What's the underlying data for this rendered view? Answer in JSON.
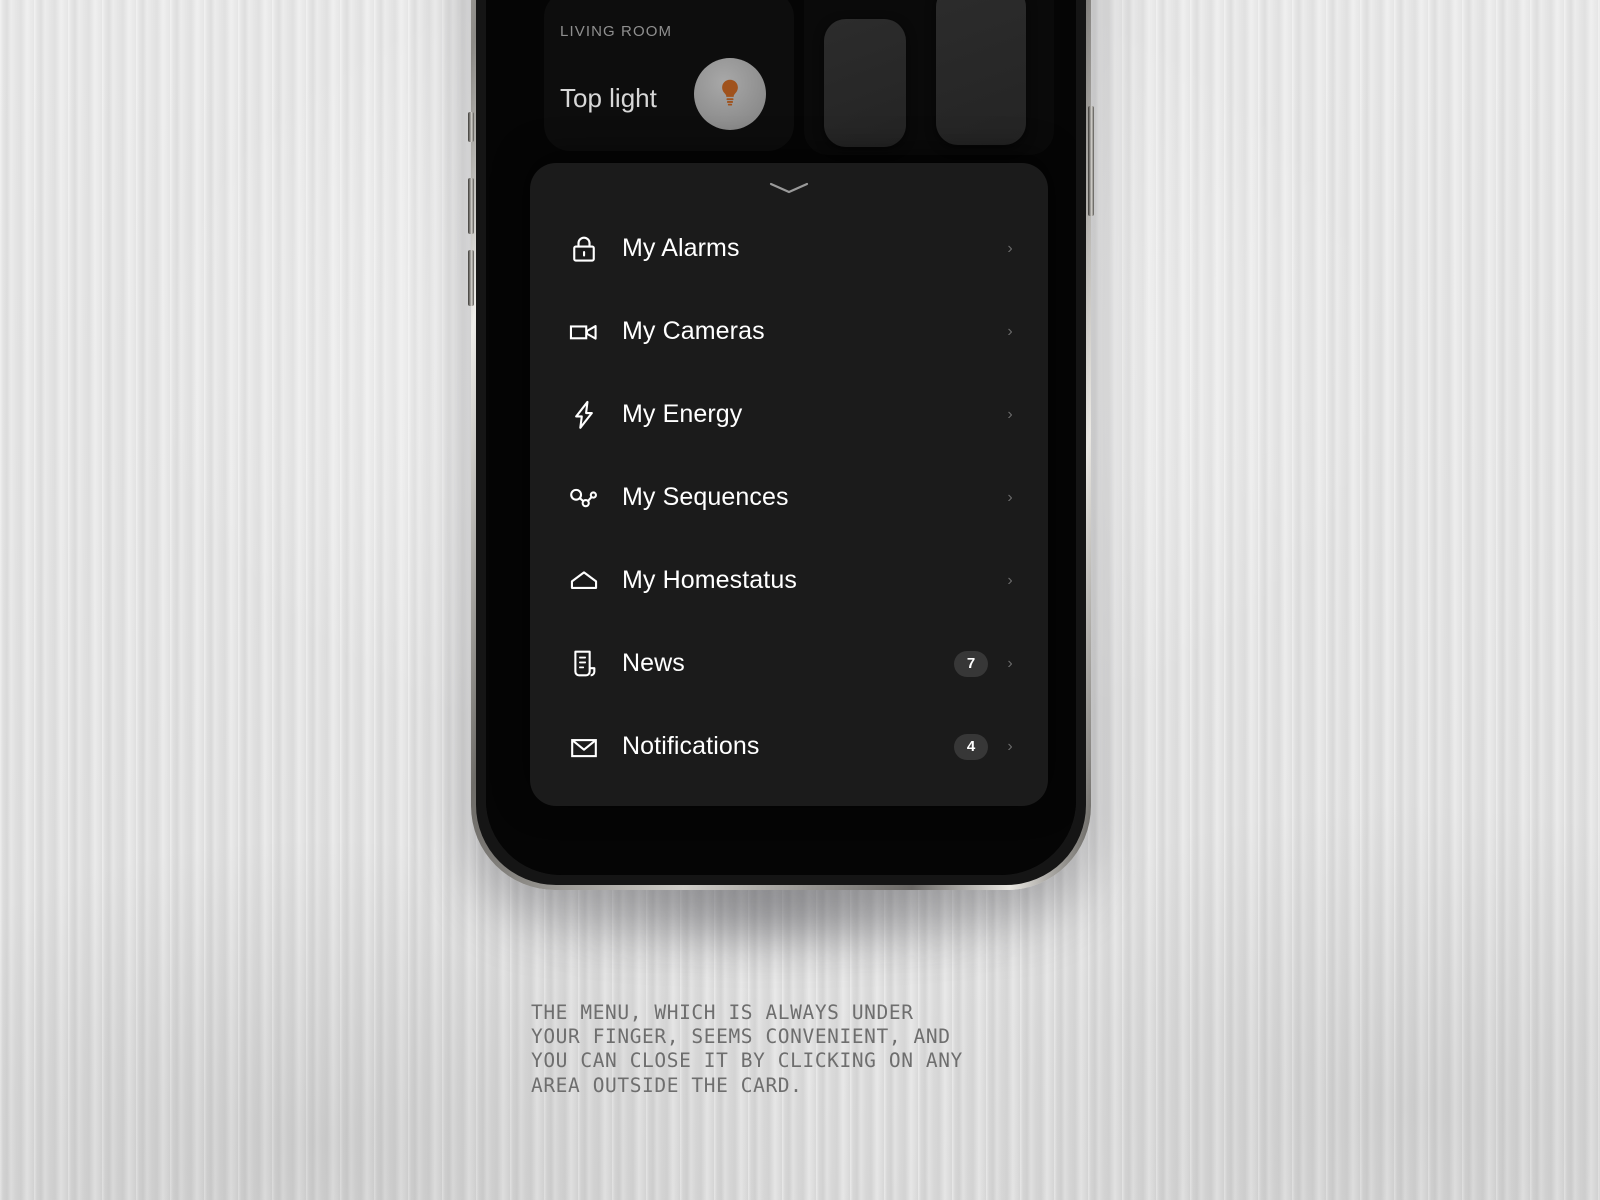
{
  "device": {
    "name": "smartphone-mockup",
    "side_buttons": [
      "mute-switch",
      "volume-up",
      "volume-down",
      "power-button"
    ]
  },
  "app": {
    "room_label": "LIVING ROOM",
    "toplight": {
      "label": "Top light",
      "icon": "lightbulb-icon",
      "icon_color": "#a0521c",
      "knob_color": "#8c8c8c"
    },
    "widgets": [
      {
        "name": "widget-tile-1"
      },
      {
        "name": "widget-tile-2"
      }
    ]
  },
  "menu": {
    "handle_icon": "chevron-down-icon",
    "card_color": "#1b1b1b",
    "badge_color": "#373737",
    "items": [
      {
        "label": "My Alarms",
        "icon": "lock-icon",
        "badge": "",
        "chevron": "›"
      },
      {
        "label": "My Cameras",
        "icon": "video-camera-icon",
        "badge": "",
        "chevron": "›"
      },
      {
        "label": "My Energy",
        "icon": "lightning-bolt-icon",
        "badge": "",
        "chevron": "›"
      },
      {
        "label": "My Sequences",
        "icon": "node-graph-icon",
        "badge": "",
        "chevron": "›"
      },
      {
        "label": "My Homestatus",
        "icon": "home-outline-icon",
        "badge": "",
        "chevron": "›"
      },
      {
        "label": "News",
        "icon": "document-list-icon",
        "badge": "7",
        "chevron": "›"
      },
      {
        "label": "Notifications",
        "icon": "envelope-icon",
        "badge": "4",
        "chevron": "›"
      }
    ]
  },
  "caption": {
    "text": "THE MENU, WHICH IS ALWAYS UNDER\nYOUR FINGER, SEEMS CONVENIENT, AND\nYOU CAN CLOSE IT BY CLICKING ON ANY\nAREA OUTSIDE THE CARD.",
    "color": "#6e6e6e"
  }
}
